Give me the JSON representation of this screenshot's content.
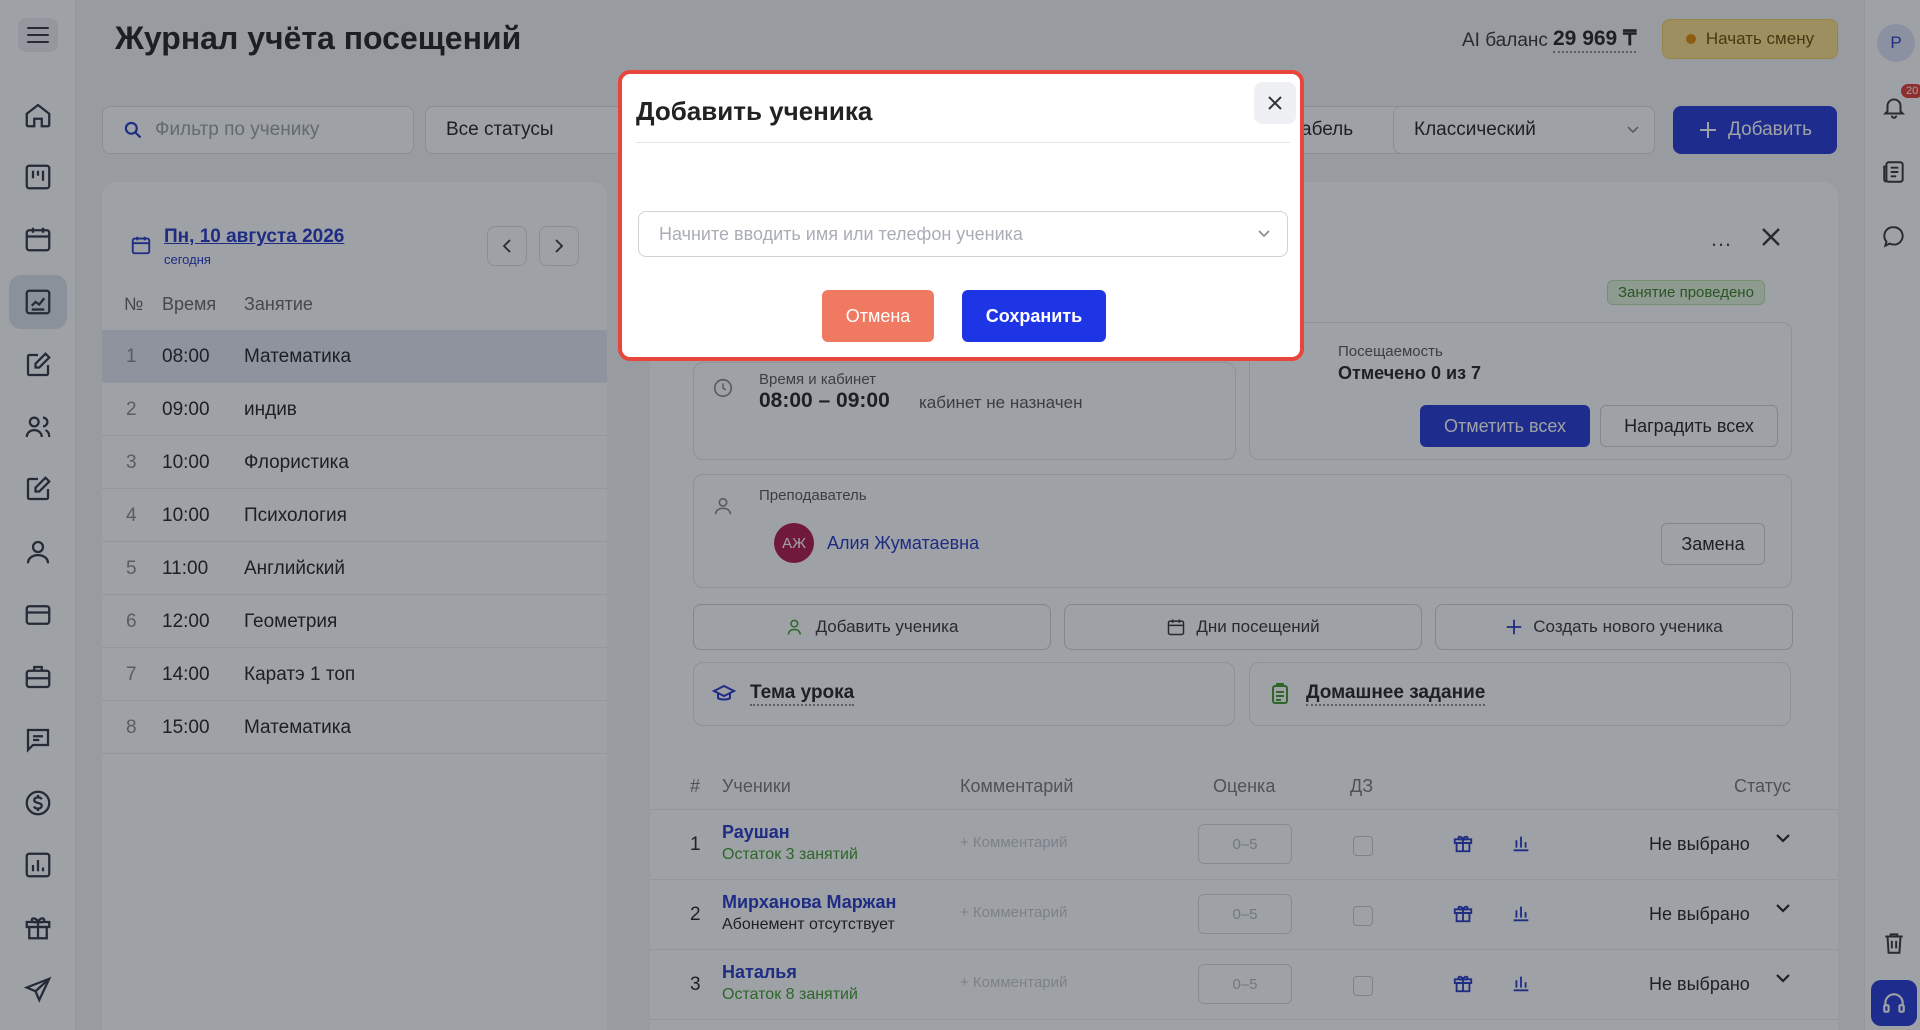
{
  "header": {
    "title": "Журнал учёта посещений",
    "ai_balance_label": "AI баланс",
    "ai_balance_value": "29 969 ₸",
    "start_shift_label": "Начать смену"
  },
  "toolbar": {
    "search_placeholder": "Фильтр по ученику",
    "status_filter": "Все статусы",
    "tab_label": "абель",
    "view_select": "Классический",
    "add_label": "Добавить"
  },
  "notifications": {
    "count": "20"
  },
  "user": {
    "initial": "Р"
  },
  "schedule": {
    "date": "Пн, 10 августа 2026",
    "date_sub": "сегодня",
    "columns": [
      "№",
      "Время",
      "Занятие"
    ],
    "lessons": [
      {
        "n": "1",
        "time": "08:00",
        "subject": "Математика"
      },
      {
        "n": "2",
        "time": "09:00",
        "subject": "индив"
      },
      {
        "n": "3",
        "time": "10:00",
        "subject": "Флористика"
      },
      {
        "n": "4",
        "time": "10:00",
        "subject": "Психология"
      },
      {
        "n": "5",
        "time": "11:00",
        "subject": "Английский"
      },
      {
        "n": "6",
        "time": "12:00",
        "subject": "Геометрия"
      },
      {
        "n": "7",
        "time": "14:00",
        "subject": "Каратэ 1 топ"
      },
      {
        "n": "8",
        "time": "15:00",
        "subject": "Математика"
      }
    ]
  },
  "lesson": {
    "more": "…",
    "status_badge": "Занятие проведено",
    "time_label": "Время и кабинет",
    "time_value": "08:00 – 09:00",
    "room": "кабинет не назначен",
    "attendance_label": "Посещаемость",
    "attendance_value": "Отмечено 0 из 7",
    "mark_all": "Отметить всех",
    "reward_all": "Наградить всех",
    "teacher_label": "Преподаватель",
    "teacher_initials": "АЖ",
    "teacher_name": "Алия Жуматаевна",
    "replace": "Замена",
    "add_student": "Добавить ученика",
    "visit_days": "Дни посещений",
    "create_student": "Создать нового ученика",
    "topic": "Тема урока",
    "homework": "Домашнее задание"
  },
  "students_table": {
    "columns": {
      "num": "#",
      "students": "Ученики",
      "comment": "Комментарий",
      "grade": "Оценка",
      "hw": "ДЗ",
      "status": "Статус"
    },
    "rows": [
      {
        "n": "1",
        "name": "Раушан",
        "sub": "Остаток 3 занятий",
        "sub_color": "#3e9a2b",
        "comment_placeholder": "+ Комментарий",
        "grade_placeholder": "0–5",
        "status": "Не выбрано"
      },
      {
        "n": "2",
        "name": "Мирханова Маржан",
        "sub": "Абонемент отсутствует",
        "sub_color": "#222222",
        "comment_placeholder": "+ Комментарий",
        "grade_placeholder": "0–5",
        "status": "Не выбрано"
      },
      {
        "n": "3",
        "name": "Наталья",
        "sub": "Остаток 8 занятий",
        "sub_color": "#3e9a2b",
        "comment_placeholder": "+ Комментарий",
        "grade_placeholder": "0–5",
        "status": "Не выбрано"
      }
    ]
  },
  "modal": {
    "title": "Добавить ученика",
    "input_placeholder": "Начните вводить имя или телефон ученика",
    "cancel": "Отмена",
    "save": "Сохранить"
  },
  "colors": {
    "accent": "#2437d6",
    "danger_outline": "#e8453c",
    "cancel": "#ef7a61",
    "success": "#3e9a2b"
  }
}
